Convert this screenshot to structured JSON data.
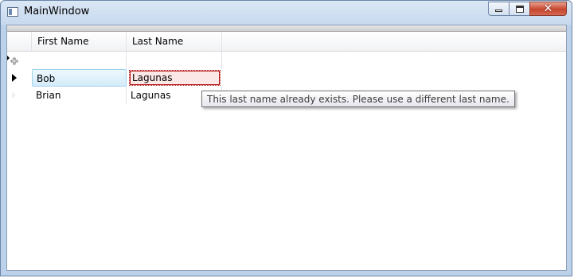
{
  "window": {
    "title": "MainWindow"
  },
  "grid": {
    "columns": [
      "First Name",
      "Last Name"
    ],
    "rows": [
      {
        "first": "Bob",
        "last": "Lagunas",
        "state": "editing"
      },
      {
        "first": "Brian",
        "last": "Lagunas",
        "state": "normal"
      }
    ]
  },
  "tooltip": {
    "text": "This last name already exists.  Please use a different last name."
  },
  "icons": {
    "minimize": "minimize-icon",
    "maximize": "maximize-icon",
    "close": "close-icon",
    "new-row": "plus-icon",
    "current-row": "right-triangle-icon"
  }
}
